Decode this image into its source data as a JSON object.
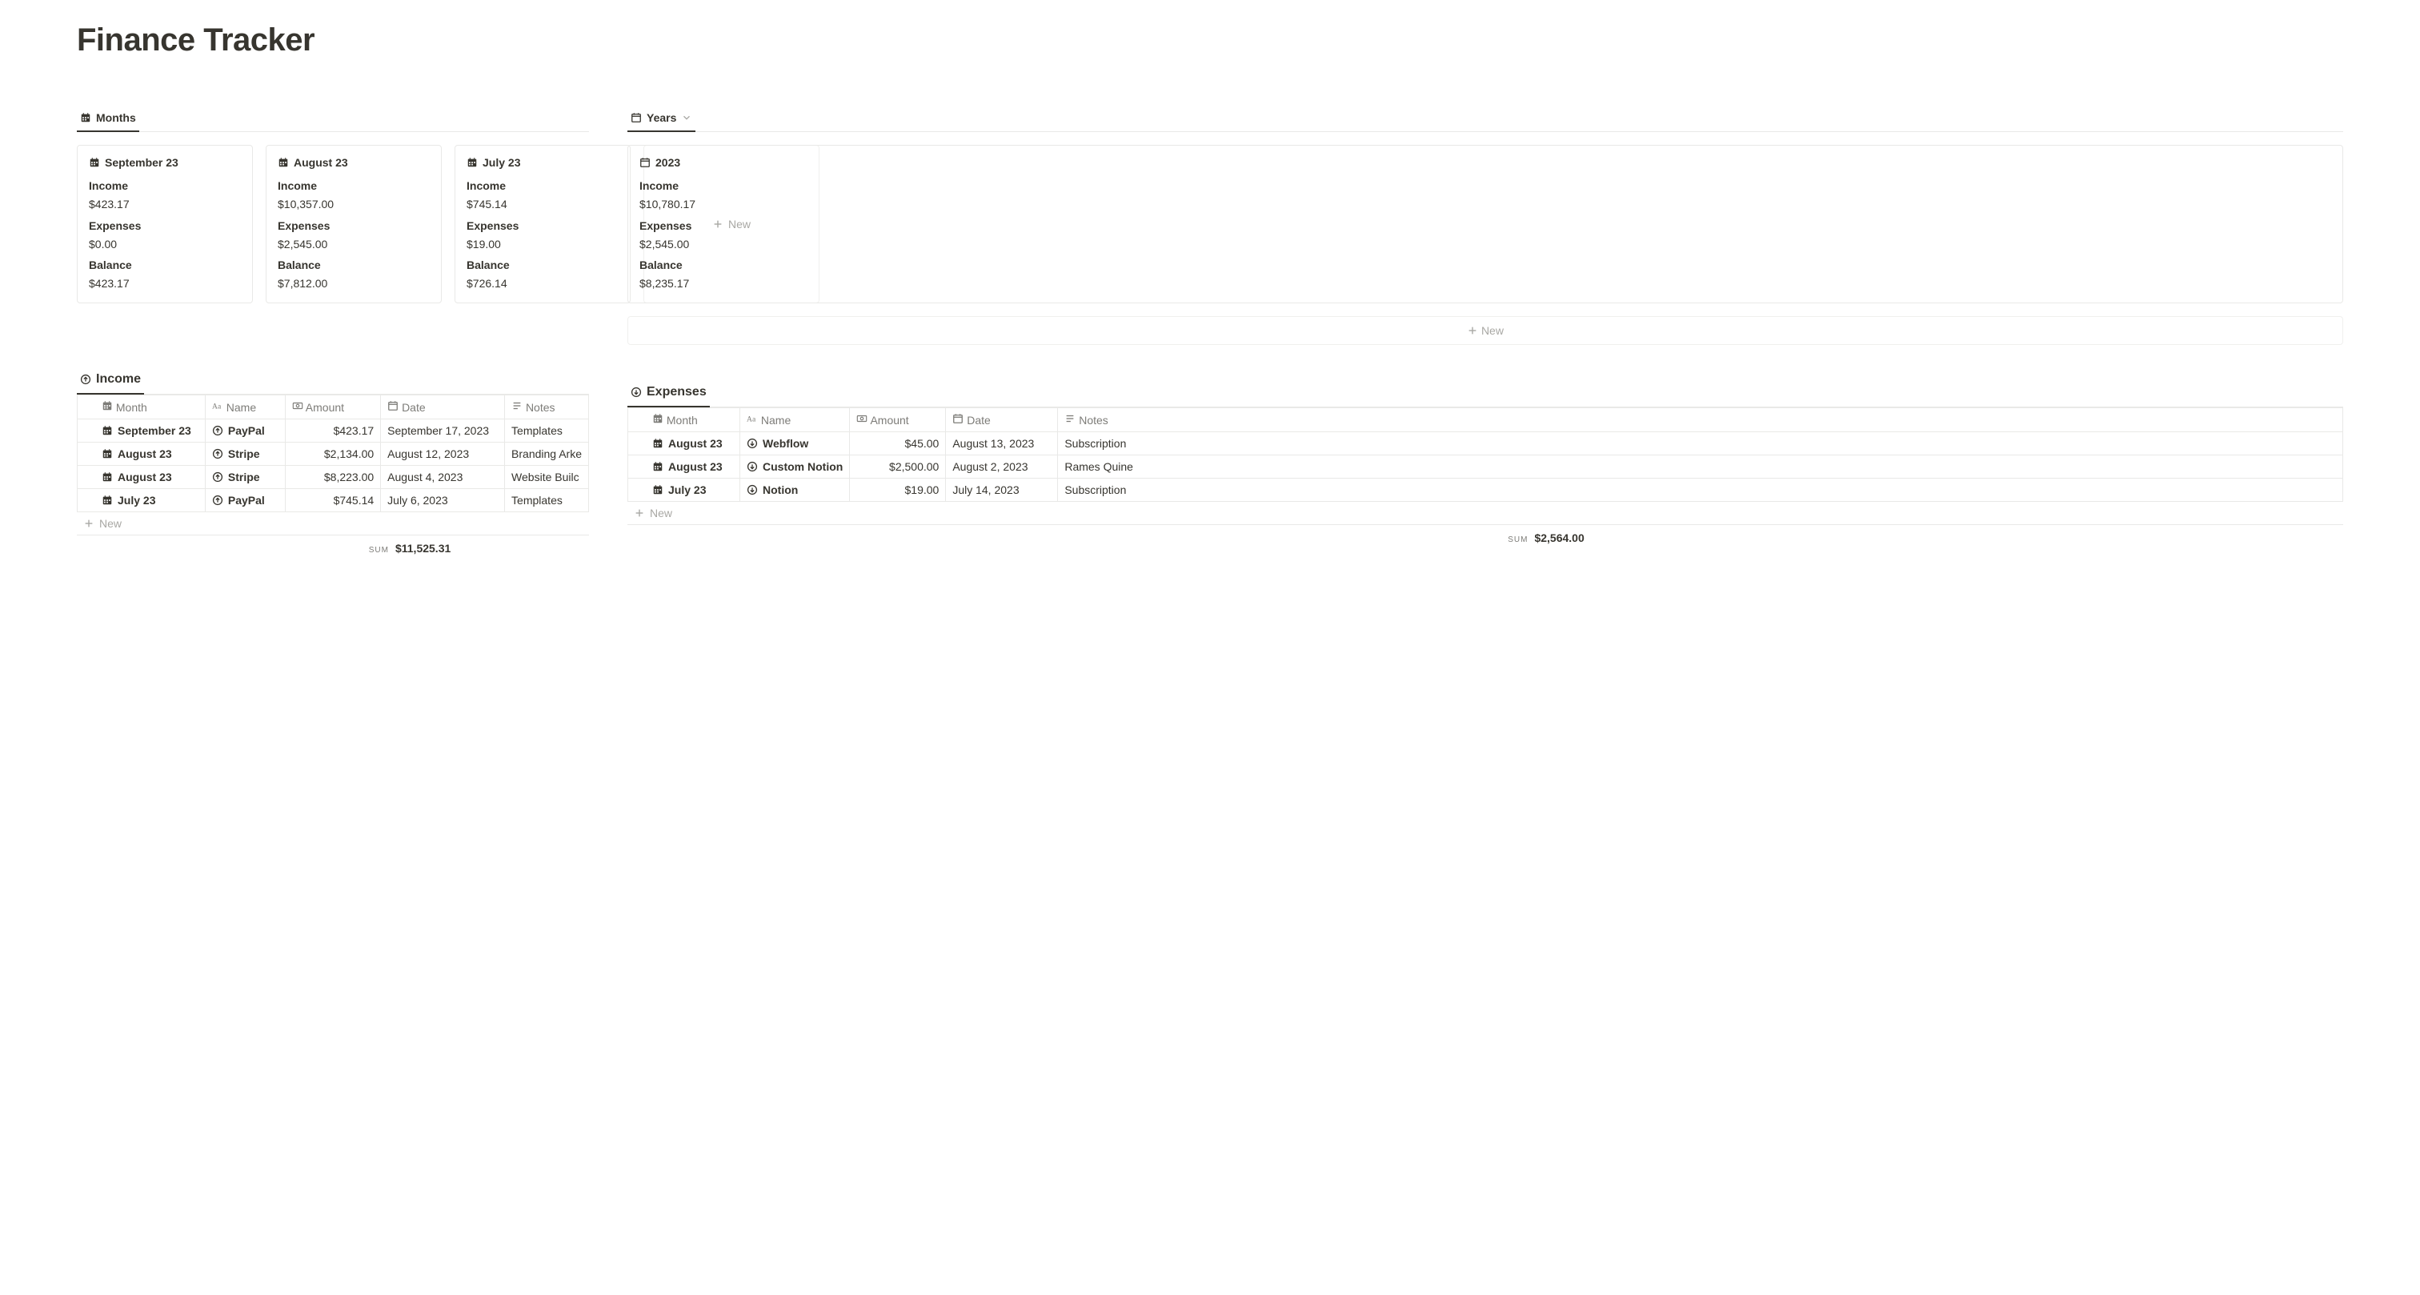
{
  "page_title": "Finance Tracker",
  "months_tab": "Months",
  "years_tab": "Years",
  "labels": {
    "income": "Income",
    "expenses": "Expenses",
    "balance": "Balance",
    "new": "New",
    "sum": "SUM"
  },
  "month_cards": [
    {
      "title": "September 23",
      "income": "$423.17",
      "expenses": "$0.00",
      "balance": "$423.17"
    },
    {
      "title": "August 23",
      "income": "$10,357.00",
      "expenses": "$2,545.00",
      "balance": "$7,812.00"
    },
    {
      "title": "July 23",
      "income": "$745.14",
      "expenses": "$19.00",
      "balance": "$726.14"
    }
  ],
  "year_cards": [
    {
      "title": "2023",
      "income": "$10,780.17",
      "expenses": "$2,545.00",
      "balance": "$8,235.17"
    }
  ],
  "income_section": "Income",
  "expenses_section": "Expenses",
  "income_cols": {
    "month": "Month",
    "name": "Name",
    "amount": "Amount",
    "date": "Date",
    "notes": "Notes"
  },
  "expenses_cols": {
    "month": "Month",
    "name": "Name",
    "amount": "Amount",
    "date": "Date",
    "notes": "Notes"
  },
  "income_rows": [
    {
      "month": "September 23",
      "name": "PayPal",
      "amount": "$423.17",
      "date": "September 17, 2023",
      "notes": "Templates"
    },
    {
      "month": "August 23",
      "name": "Stripe",
      "amount": "$2,134.00",
      "date": "August 12, 2023",
      "notes": "Branding Arke"
    },
    {
      "month": "August 23",
      "name": "Stripe",
      "amount": "$8,223.00",
      "date": "August 4, 2023",
      "notes": "Website Builc"
    },
    {
      "month": "July 23",
      "name": "PayPal",
      "amount": "$745.14",
      "date": "July 6, 2023",
      "notes": "Templates"
    }
  ],
  "expenses_rows": [
    {
      "month": "August 23",
      "name": "Webflow",
      "amount": "$45.00",
      "date": "August 13, 2023",
      "notes": "Subscription"
    },
    {
      "month": "August 23",
      "name": "Custom Notion",
      "amount": "$2,500.00",
      "date": "August 2, 2023",
      "notes": "Rames Quine"
    },
    {
      "month": "July 23",
      "name": "Notion",
      "amount": "$19.00",
      "date": "July 14, 2023",
      "notes": "Subscription"
    }
  ],
  "income_sum": "$11,525.31",
  "expenses_sum": "$2,564.00"
}
